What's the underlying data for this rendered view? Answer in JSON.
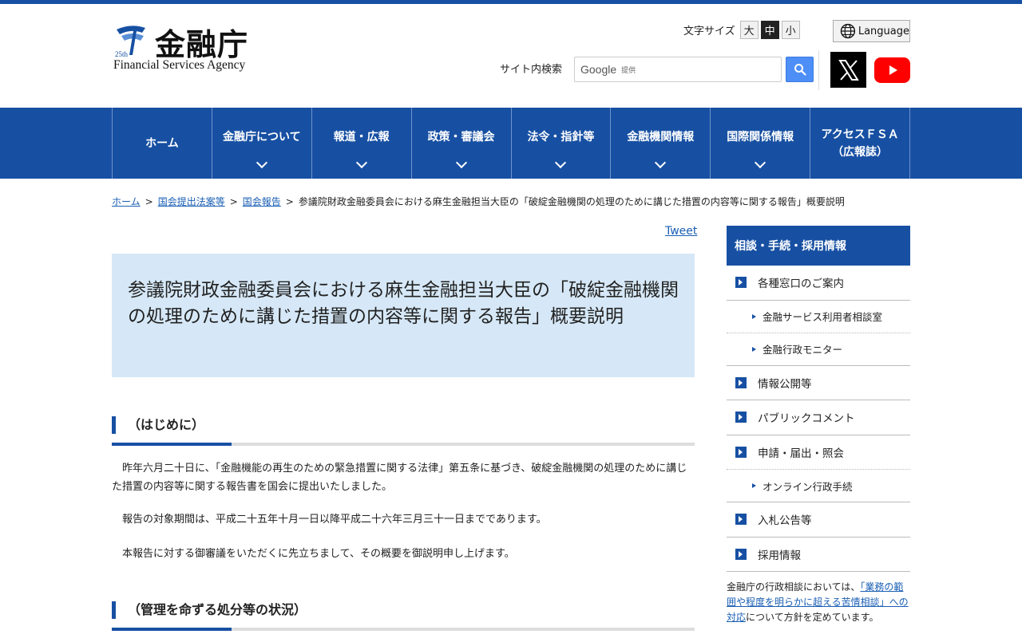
{
  "header": {
    "logo_jp": "金融庁",
    "logo_en": "Financial Services Agency",
    "logo_badge": "25th",
    "font_size_label": "文字サイズ",
    "font_sizes": [
      "大",
      "中",
      "小"
    ],
    "font_size_selected": "中",
    "language_label": "Language",
    "search_label": "サイト内検索",
    "search_brand": "Google",
    "search_brand_suffix": "提供"
  },
  "nav": {
    "items": [
      {
        "label": "ホーム"
      },
      {
        "label": "金融庁について"
      },
      {
        "label": "報道・広報"
      },
      {
        "label": "政策・審議会"
      },
      {
        "label": "法令・指針等"
      },
      {
        "label": "金融機関情報"
      },
      {
        "label": "国際関係情報"
      },
      {
        "label_line1": "アクセスＦＳＡ",
        "label_line2": "（広報誌）"
      }
    ]
  },
  "breadcrumb": {
    "items": [
      "ホーム",
      "国会提出法案等",
      "国会報告"
    ],
    "current": "参議院財政金融委員会における麻生金融担当大臣の「破綻金融機関の処理のために講じた措置の内容等に関する報告」概要説明"
  },
  "tweet_label": "Tweet",
  "page_title": "参議院財政金融委員会における麻生金融担当大臣の「破綻金融機関の処理のために講じた措置の内容等に関する報告」概要説明",
  "sections": [
    {
      "heading": "（はじめに）"
    },
    {
      "heading": "（管理を命ずる処分等の状況）"
    }
  ],
  "paragraphs": [
    "昨年六月二十日に、「金融機能の再生のための緊急措置に関する法律」第五条に基づき、破綻金融機関の処理のために講じた措置の内容等に関する報告書を国会に提出いたしました。",
    "報告の対象期間は、平成二十五年十月一日以降平成二十六年三月三十一日までであります。",
    "本報告に対する御審議をいただくに先立ちまして、その概要を御説明申し上げます。"
  ],
  "sidebar": {
    "heading": "相談・手続・採用情報",
    "items": {
      "madoguchi": "各種窓口のご案内",
      "riyosha": "金融サービス利用者相談室",
      "monitor": "金融行政モニター",
      "joho": "情報公開等",
      "public": "パブリックコメント",
      "shinsei": "申請・届出・照会",
      "online": "オンライン行政手続",
      "nyusatsu": "入札公告等",
      "saiyo": "採用情報"
    },
    "note_pre": "金融庁の行政相談においては、",
    "note_link": "「業務の範囲や程度を明らかに超える苦情相談」への対応",
    "note_post": "について方針を定めています。"
  },
  "colors": {
    "brand_blue": "#1750a3",
    "title_bg": "#d6e8f7",
    "link": "#1a5fb4",
    "search_button": "#4d8ef7",
    "youtube_red": "#ff0000"
  },
  "icons": [
    "globe-icon",
    "search-icon",
    "x-logo-icon",
    "youtube-icon",
    "chevron-down-icon"
  ]
}
